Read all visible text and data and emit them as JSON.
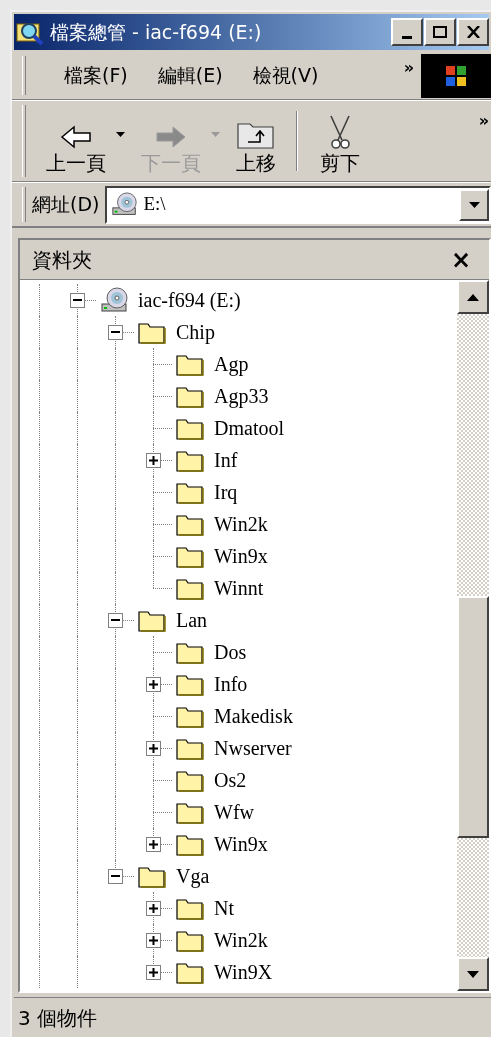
{
  "window": {
    "title": "檔案總管 - iac-f694 (E:)"
  },
  "menu": [
    "檔案(F)",
    "編輯(E)",
    "檢視(V)"
  ],
  "menu_more": "»",
  "toolbar": [
    {
      "kind": "back",
      "label": "上一頁",
      "disabled": false,
      "dropdown": true
    },
    {
      "kind": "forward",
      "label": "下一頁",
      "disabled": true,
      "dropdown": true
    },
    {
      "kind": "up",
      "label": "上移",
      "disabled": false,
      "dropdown": false
    },
    {
      "kind": "cut",
      "label": "剪下",
      "disabled": false,
      "dropdown": false
    }
  ],
  "toolbar_more": "»",
  "address": {
    "label": "網址(D)",
    "value": "E:\\"
  },
  "folders_pane": {
    "title": "資料夾",
    "close": "×"
  },
  "tree": [
    {
      "kind": "drive",
      "label": "iac-f694 (E:)",
      "expandable": true,
      "expanded": true,
      "children": [
        {
          "kind": "folder",
          "label": "Chip",
          "expandable": true,
          "expanded": true,
          "children": [
            {
              "kind": "folder",
              "label": "Agp",
              "expandable": false
            },
            {
              "kind": "folder",
              "label": "Agp33",
              "expandable": false
            },
            {
              "kind": "folder",
              "label": "Dmatool",
              "expandable": false
            },
            {
              "kind": "folder",
              "label": "Inf",
              "expandable": true,
              "expanded": false
            },
            {
              "kind": "folder",
              "label": "Irq",
              "expandable": false
            },
            {
              "kind": "folder",
              "label": "Win2k",
              "expandable": false
            },
            {
              "kind": "folder",
              "label": "Win9x",
              "expandable": false
            },
            {
              "kind": "folder",
              "label": "Winnt",
              "expandable": false
            }
          ]
        },
        {
          "kind": "folder",
          "label": "Lan",
          "expandable": true,
          "expanded": true,
          "children": [
            {
              "kind": "folder",
              "label": "Dos",
              "expandable": false
            },
            {
              "kind": "folder",
              "label": "Info",
              "expandable": true,
              "expanded": false
            },
            {
              "kind": "folder",
              "label": "Makedisk",
              "expandable": false
            },
            {
              "kind": "folder",
              "label": "Nwserver",
              "expandable": true,
              "expanded": false
            },
            {
              "kind": "folder",
              "label": "Os2",
              "expandable": false
            },
            {
              "kind": "folder",
              "label": "Wfw",
              "expandable": false
            },
            {
              "kind": "folder",
              "label": "Win9x",
              "expandable": true,
              "expanded": false
            }
          ]
        },
        {
          "kind": "folder",
          "label": "Vga",
          "expandable": true,
          "expanded": true,
          "children": [
            {
              "kind": "folder",
              "label": "Nt",
              "expandable": true,
              "expanded": false
            },
            {
              "kind": "folder",
              "label": "Win2k",
              "expandable": true,
              "expanded": false
            },
            {
              "kind": "folder",
              "label": "Win9X",
              "expandable": true,
              "expanded": false
            }
          ]
        }
      ]
    }
  ],
  "status_bar": "3 個物件"
}
